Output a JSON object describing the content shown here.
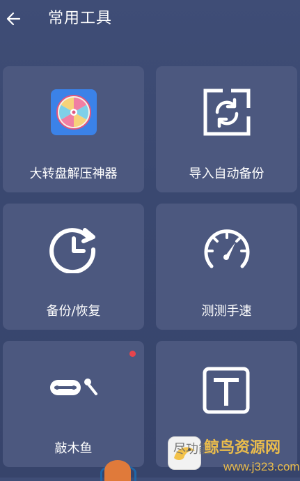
{
  "header": {
    "title": "常用工具",
    "back_icon": "arrow-left-icon"
  },
  "tools": [
    {
      "label": "大转盘解压神器",
      "icon": "prize-wheel-icon"
    },
    {
      "label": "导入自动备份",
      "icon": "import-sync-icon"
    },
    {
      "label": "备份/恢复",
      "icon": "clock-restore-icon"
    },
    {
      "label": "测测手速",
      "icon": "speedometer-icon"
    },
    {
      "label": "敲木鱼",
      "icon": "wooden-fish-icon",
      "badge": "new-dot"
    },
    {
      "label": "",
      "icon": "text-box-icon"
    }
  ],
  "watermark": {
    "prefix": "尽功能",
    "name": "鲸鸟资源网",
    "url": "www.j323.com"
  },
  "colors": {
    "background": "#3d4a72",
    "card": "#4c587f",
    "badge": "#e8444c",
    "watermark": "#f3c24a"
  }
}
